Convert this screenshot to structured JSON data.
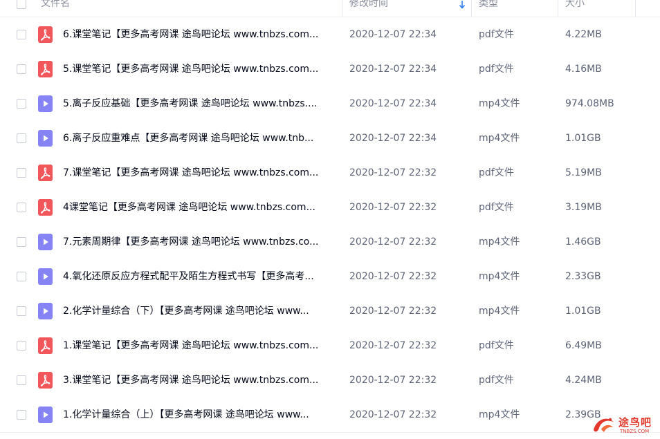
{
  "header": {
    "name_label": "文件名",
    "modified_label": "修改时间",
    "type_label": "类型",
    "size_label": "大小"
  },
  "colors": {
    "pdf_icon": "#f0565a",
    "video_icon": "#8683f5",
    "sort_arrow": "#2f7df6",
    "watermark": "#e2382c"
  },
  "rows": [
    {
      "icon": "pdf-icon",
      "name": "6.课堂笔记【更多高考网课 途鸟吧论坛 www.tnbzs.com...",
      "date": "2020-12-07 22:34",
      "type": "pdf文件",
      "size": "4.22MB"
    },
    {
      "icon": "pdf-icon",
      "name": "5.课堂笔记【更多高考网课 途鸟吧论坛 www.tnbzs.com...",
      "date": "2020-12-07 22:34",
      "type": "pdf文件",
      "size": "4.16MB"
    },
    {
      "icon": "video-icon",
      "name": "5.离子反应基础【更多高考网课 途鸟吧论坛 www.tnbzs....",
      "date": "2020-12-07 22:34",
      "type": "mp4文件",
      "size": "974.08MB"
    },
    {
      "icon": "video-icon",
      "name": "6.离子反应重难点【更多高考网课 途鸟吧论坛 www.tnb...",
      "date": "2020-12-07 22:34",
      "type": "mp4文件",
      "size": "1.01GB"
    },
    {
      "icon": "pdf-icon",
      "name": "7.课堂笔记【更多高考网课 途鸟吧论坛 www.tnbzs.com...",
      "date": "2020-12-07 22:32",
      "type": "pdf文件",
      "size": "5.19MB"
    },
    {
      "icon": "pdf-icon",
      "name": "4课堂笔记【更多高考网课 途鸟吧论坛 www.tnbzs.com...",
      "date": "2020-12-07 22:32",
      "type": "pdf文件",
      "size": "3.19MB"
    },
    {
      "icon": "video-icon",
      "name": "7.元素周期律【更多高考网课 途鸟吧论坛 www.tnbzs.co...",
      "date": "2020-12-07 22:32",
      "type": "mp4文件",
      "size": "1.46GB"
    },
    {
      "icon": "video-icon",
      "name": "4.氧化还原反应方程式配平及陌生方程式书写【更多高考...",
      "date": "2020-12-07 22:32",
      "type": "mp4文件",
      "size": "2.33GB"
    },
    {
      "icon": "video-icon",
      "name": "2.化学计量综合（下）【更多高考网课 途鸟吧论坛 www...",
      "date": "2020-12-07 22:32",
      "type": "mp4文件",
      "size": "1.01GB"
    },
    {
      "icon": "pdf-icon",
      "name": "1.课堂笔记【更多高考网课 途鸟吧论坛 www.tnbzs.com...",
      "date": "2020-12-07 22:32",
      "type": "pdf文件",
      "size": "6.49MB"
    },
    {
      "icon": "pdf-icon",
      "name": "3.课堂笔记【更多高考网课 途鸟吧论坛 www.tnbzs.com...",
      "date": "2020-12-07 22:32",
      "type": "pdf文件",
      "size": "4.24MB"
    },
    {
      "icon": "video-icon",
      "name": "1.化学计量综合（上）【更多高考网课 途鸟吧论坛 www...",
      "date": "2020-12-07 22:32",
      "type": "mp4文件",
      "size": "2.39GB"
    }
  ],
  "watermark": {
    "logo": "tunb-logo-icon",
    "text": "途鸟吧",
    "sub": "TNBZS.COM"
  }
}
